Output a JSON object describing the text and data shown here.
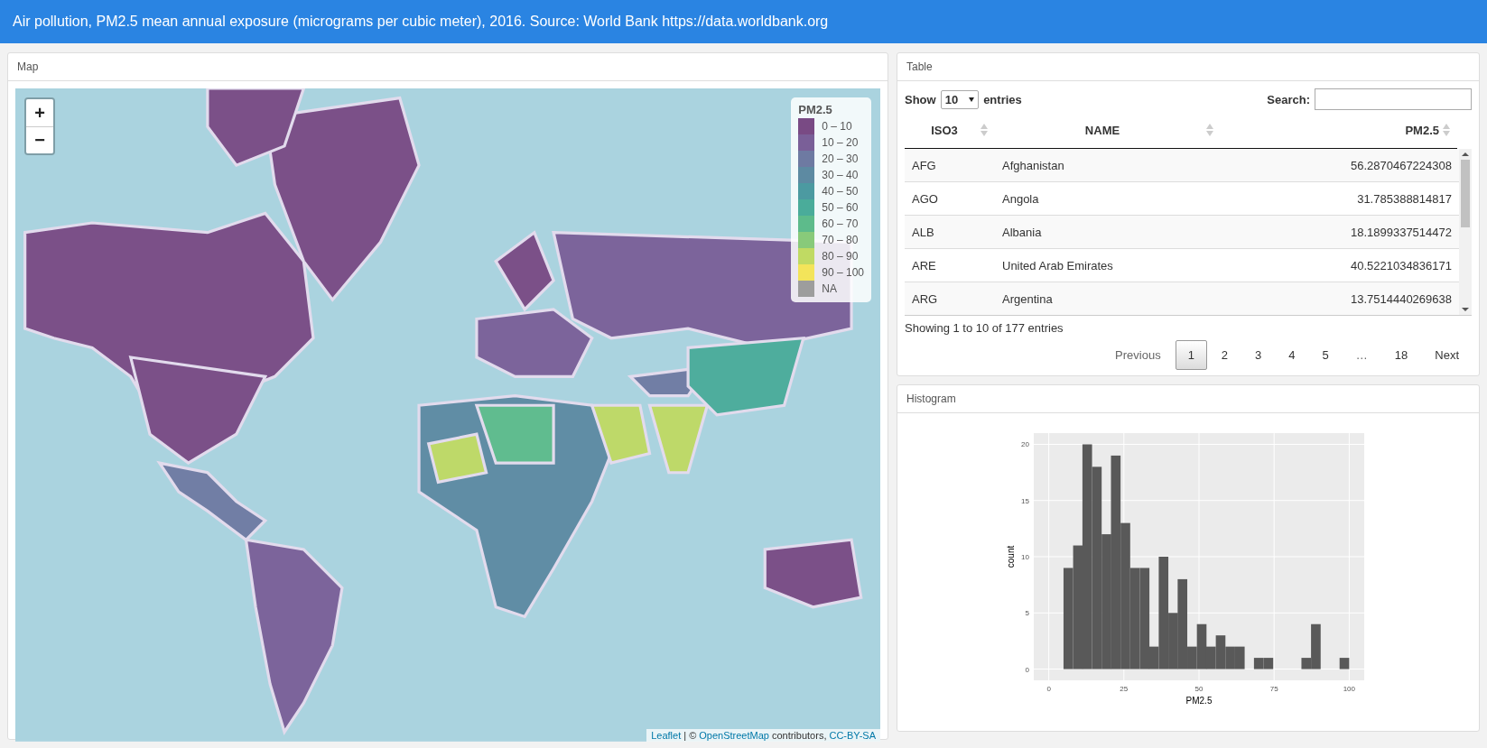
{
  "header": {
    "title": "Air pollution, PM2.5 mean annual exposure (micrograms per cubic meter), 2016. Source: World Bank https://data.worldbank.org"
  },
  "map_panel": {
    "title": "Map",
    "zoom_in": "+",
    "zoom_out": "−",
    "legend": {
      "title": "PM2.5",
      "items": [
        {
          "label": "0 – 10",
          "color": "#794a84"
        },
        {
          "label": "10 – 20",
          "color": "#7a5f98"
        },
        {
          "label": "20 – 30",
          "color": "#6e7aa2"
        },
        {
          "label": "30 – 40",
          "color": "#5d8aa2"
        },
        {
          "label": "40 – 50",
          "color": "#4c9aa1"
        },
        {
          "label": "50 – 60",
          "color": "#4aac9a"
        },
        {
          "label": "60 – 70",
          "color": "#5dbb8b"
        },
        {
          "label": "70 – 80",
          "color": "#88ca7a"
        },
        {
          "label": "80 – 90",
          "color": "#c0da63"
        },
        {
          "label": "90 – 100",
          "color": "#f3e45a"
        },
        {
          "label": "NA",
          "color": "#9d9d9d"
        }
      ]
    },
    "attribution": {
      "leaflet": "Leaflet",
      "separator": "| ©",
      "osm": "OpenStreetMap",
      "contributors": "contributors,",
      "license": "CC-BY-SA"
    }
  },
  "table_panel": {
    "title": "Table",
    "show_label": "Show",
    "page_size": "10",
    "entries_label": "entries",
    "search_label": "Search:",
    "columns": [
      "ISO3",
      "NAME",
      "PM2.5"
    ],
    "rows": [
      [
        "AFG",
        "Afghanistan",
        "56.2870467224308"
      ],
      [
        "AGO",
        "Angola",
        "31.785388814817"
      ],
      [
        "ALB",
        "Albania",
        "18.1899337514472"
      ],
      [
        "ARE",
        "United Arab Emirates",
        "40.5221034836171"
      ],
      [
        "ARG",
        "Argentina",
        "13.7514440269638"
      ]
    ],
    "info": "Showing 1 to 10 of 177 entries",
    "pagination": [
      {
        "label": "Previous",
        "selected": false,
        "disabled": true
      },
      {
        "label": "1",
        "selected": true,
        "disabled": false
      },
      {
        "label": "2",
        "selected": false,
        "disabled": false
      },
      {
        "label": "3",
        "selected": false,
        "disabled": false
      },
      {
        "label": "4",
        "selected": false,
        "disabled": false
      },
      {
        "label": "5",
        "selected": false,
        "disabled": false
      },
      {
        "label": "…",
        "selected": false,
        "disabled": true
      },
      {
        "label": "18",
        "selected": false,
        "disabled": false
      },
      {
        "label": "Next",
        "selected": false,
        "disabled": false
      }
    ]
  },
  "histogram_panel": {
    "title": "Histogram",
    "chart_data": {
      "type": "bar",
      "xlabel": "PM2.5",
      "ylabel": "count",
      "x": [
        6.5,
        9.7,
        12.8,
        16.0,
        19.2,
        22.3,
        25.5,
        28.7,
        31.9,
        35.0,
        38.2,
        41.4,
        44.5,
        47.7,
        50.9,
        54.0,
        57.2,
        60.4,
        63.6,
        66.7,
        69.9,
        73.1,
        76.2,
        79.4,
        82.6,
        85.7,
        88.9,
        92.1,
        95.3,
        98.4
      ],
      "values": [
        9,
        11,
        20,
        18,
        12,
        19,
        13,
        9,
        9,
        2,
        10,
        5,
        8,
        2,
        4,
        2,
        3,
        2,
        2,
        0,
        1,
        1,
        0,
        0,
        0,
        1,
        4,
        0,
        0,
        1
      ],
      "grid": true,
      "xlim": [
        -5,
        105
      ],
      "ylim": [
        -1,
        21
      ],
      "xticks": [
        0,
        25,
        50,
        75,
        100
      ],
      "yticks": [
        0,
        5,
        10,
        15,
        20
      ]
    }
  }
}
